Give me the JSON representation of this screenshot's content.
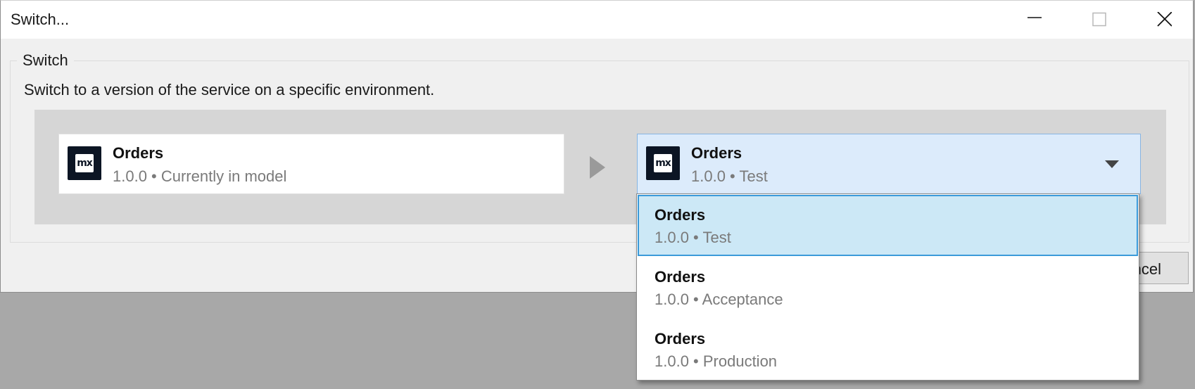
{
  "window": {
    "title": "Switch...",
    "controls": [
      "minimize-icon",
      "maximize-icon",
      "close-icon"
    ]
  },
  "group": {
    "legend": "Switch",
    "description": "Switch to a version of the service on a specific environment."
  },
  "current": {
    "logo_text": "mx",
    "name": "Orders",
    "detail": "1.0.0 • Currently in model"
  },
  "target": {
    "logo_text": "mx",
    "name": "Orders",
    "detail": "1.0.0 • Test"
  },
  "dropdown": {
    "options": [
      {
        "name": "Orders",
        "detail": "1.0.0 • Test",
        "selected": true
      },
      {
        "name": "Orders",
        "detail": "1.0.0 • Acceptance",
        "selected": false
      },
      {
        "name": "Orders",
        "detail": "1.0.0 • Production",
        "selected": false
      }
    ]
  },
  "buttons": {
    "cancel_partial": "Cancel"
  },
  "colors": {
    "selection_bg": "#cce8f6",
    "selection_border": "#3a9ad9",
    "logo_bg": "#0c1524"
  }
}
